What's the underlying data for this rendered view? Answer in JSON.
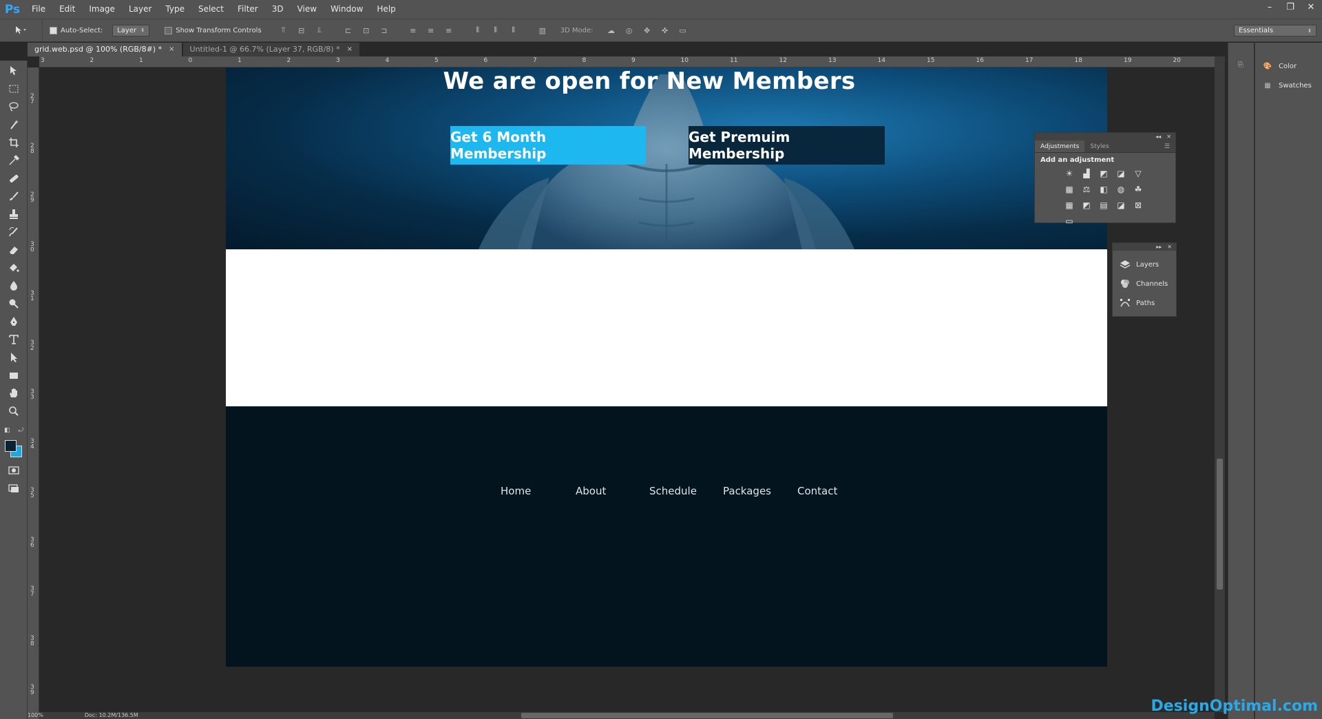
{
  "app": {
    "logo": "Ps"
  },
  "menu": [
    "File",
    "Edit",
    "Image",
    "Layer",
    "Type",
    "Select",
    "Filter",
    "3D",
    "View",
    "Window",
    "Help"
  ],
  "window_controls": [
    "–",
    "❐",
    "✕"
  ],
  "options": {
    "auto_select_label": "Auto-Select:",
    "auto_select_value": "Layer",
    "show_transform_label": "Show Transform Controls",
    "mode_3d_label": "3D Mode:",
    "workspace": "Essentials"
  },
  "tabs": [
    {
      "label": "grid.web.psd @ 100% (RGB/8#) *",
      "close": "×"
    },
    {
      "label": "Untitled-1 @ 66.7% (Layer 37, RGB/8) *",
      "close": "×"
    }
  ],
  "ruler_h": [
    "3",
    "2",
    "1",
    "0",
    "1",
    "2",
    "3",
    "4",
    "5",
    "6",
    "7",
    "8",
    "9",
    "10",
    "11",
    "12",
    "13",
    "14",
    "15",
    "16",
    "17",
    "18",
    "19",
    "20"
  ],
  "ruler_v": [
    "2\n7",
    "2\n8",
    "2\n9",
    "3\n0",
    "3\n1",
    "3\n2",
    "3\n3",
    "3\n4",
    "3\n5",
    "3\n6",
    "3\n7",
    "3\n8",
    "3\n9"
  ],
  "canvas": {
    "hero_title": "We are open for New Members",
    "btn_primary": "Get 6 Month Membership",
    "btn_dark": "Get Premuim Membership",
    "footer_nav": [
      "Home",
      "About",
      "Schedule",
      "Packages",
      "Contact"
    ]
  },
  "colors": {
    "accent_blue": "#1eb8f0",
    "dark_button": "#08263c",
    "footer_bg": "#03141f",
    "ps_blue": "#31a8ff"
  },
  "adjustments_panel": {
    "tabs": [
      "Adjustments",
      "Styles"
    ],
    "title": "Add an adjustment"
  },
  "layers_panel": {
    "items": [
      "Layers",
      "Channels",
      "Paths"
    ]
  },
  "dock": {
    "items": [
      "Color",
      "Swatches"
    ]
  },
  "status": {
    "zoom": "100%",
    "doc": "Doc: 10.2M/136.5M"
  },
  "watermark": "DesignOptimal.com"
}
